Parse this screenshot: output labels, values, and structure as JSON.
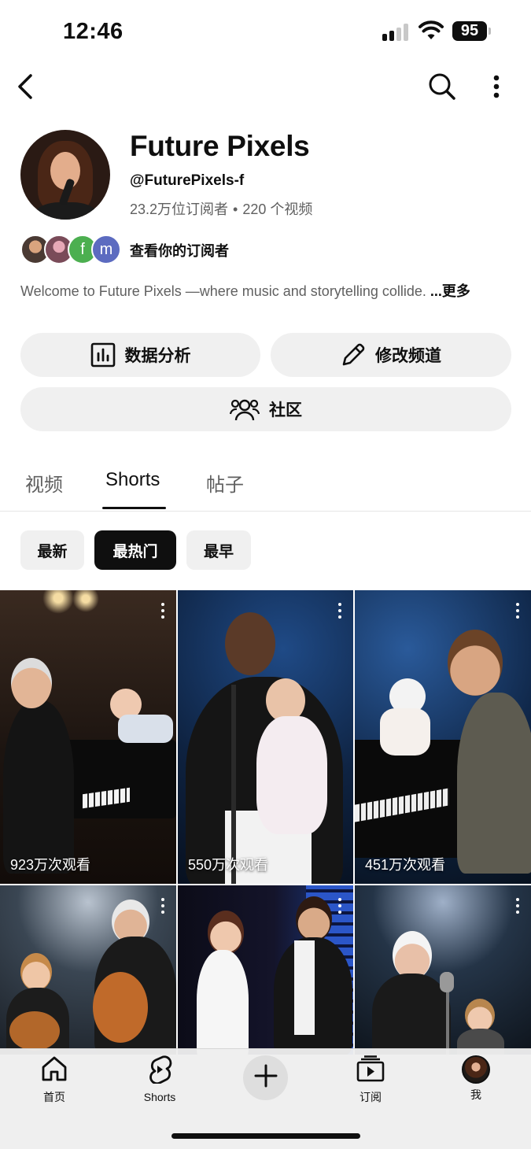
{
  "status": {
    "time": "12:46",
    "battery": "95"
  },
  "channel": {
    "name": "Future Pixels",
    "handle": "@FuturePixels-f",
    "subscribers": "23.2万位订阅者",
    "video_count": "220 个视频",
    "subscriber_avatars": [
      "",
      "",
      "f",
      "m"
    ],
    "view_subscribers": "查看你的订阅者",
    "description": "Welcome to Future Pixels —where music and storytelling collide.",
    "more_label": "...更多"
  },
  "actions": {
    "analytics": "数据分析",
    "edit_channel": "修改频道",
    "community": "社区"
  },
  "tabs": [
    "视频",
    "Shorts",
    "帖子"
  ],
  "active_tab": "Shorts",
  "chips": [
    "最新",
    "最热门",
    "最早"
  ],
  "active_chip": "最热门",
  "shorts": [
    {
      "views": "923万次观看"
    },
    {
      "views": "550万次观看"
    },
    {
      "views": "451万次观看"
    },
    {
      "views": ""
    },
    {
      "views": ""
    },
    {
      "views": ""
    }
  ],
  "bottom_nav": {
    "home": "首页",
    "shorts": "Shorts",
    "subscriptions": "订阅",
    "you": "我"
  },
  "colors": {
    "text": "#0f0f0f",
    "secondary_text": "#606060",
    "chip_bg": "#f0f0f0",
    "chip_active_bg": "#0f0f0f"
  }
}
